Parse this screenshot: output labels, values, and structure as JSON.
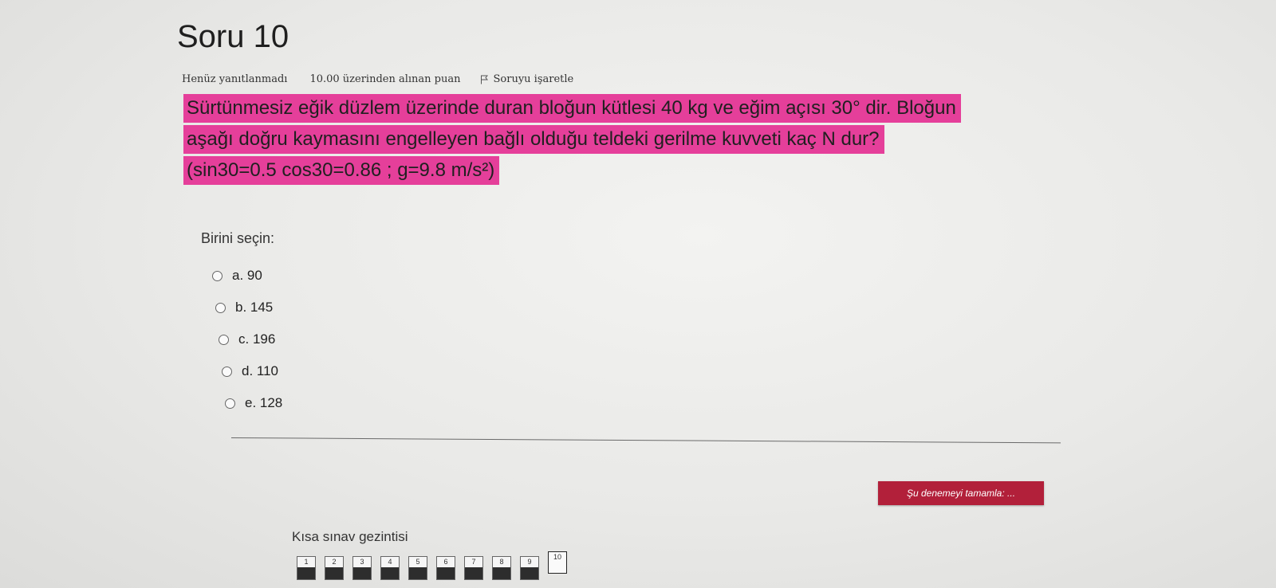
{
  "question": {
    "title": "Soru 10",
    "status": "Henüz yanıtlanmadı",
    "points": "10.00 üzerinden alınan puan",
    "flag_label": "Soruyu işaretle",
    "text_lines": [
      "Sürtünmesiz eğik düzlem üzerinde duran bloğun kütlesi 40 kg ve eğim açısı 30° dir. Bloğun",
      "aşağı doğru kaymasını engelleyen bağlı olduğu teldeki gerilme kuvveti kaç N dur?",
      "(sin30=0.5 cos30=0.86 ;  g=9.8 m/s²)"
    ],
    "highlight_color": "#e53f9a"
  },
  "answers": {
    "prompt": "Birini seçin:",
    "options": [
      "a. 90",
      "b. 145",
      "c. 196",
      "d. 110",
      "e. 128"
    ]
  },
  "finish_button": {
    "label": "Şu denemeyi tamamla: ...",
    "color": "#b2203a"
  },
  "navigation": {
    "title": "Kısa sınav gezintisi",
    "buttons": [
      "1",
      "2",
      "3",
      "4",
      "5",
      "6",
      "7",
      "8",
      "9",
      "10"
    ],
    "current": "10"
  }
}
